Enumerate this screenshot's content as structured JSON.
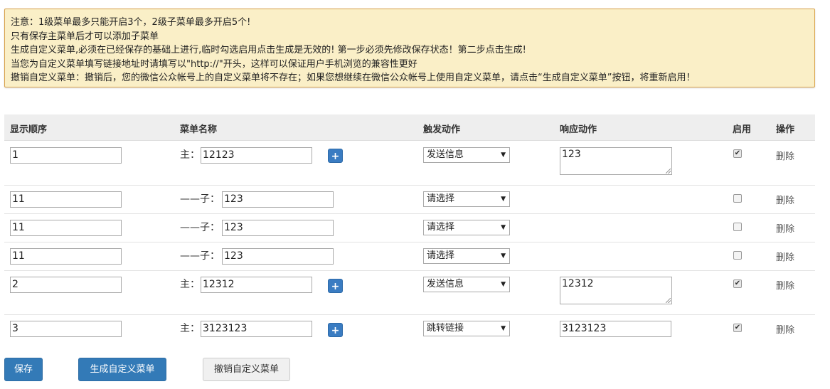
{
  "notice": [
    "注意：1级菜单最多只能开启3个，2级子菜单最多开启5个!",
    "只有保存主菜单后才可以添加子菜单",
    "生成自定义菜单,必须在已经保存的基础上进行,临时勾选启用点击生成是无效的! 第一步必须先修改保存状态！第二步点击生成!",
    "当您为自定义菜单填写链接地址时请填写以\"http://\"开头，这样可以保证用户手机浏览的兼容性更好",
    "撤销自定义菜单：撤销后，您的微信公众帐号上的自定义菜单将不存在；如果您想继续在微信公众帐号上使用自定义菜单，请点击“生成自定义菜单”按钮，将重新启用！"
  ],
  "headers": {
    "order": "显示顺序",
    "name": "菜单名称",
    "trigger": "触发动作",
    "response": "响应动作",
    "enabled": "启用",
    "ops": "操作"
  },
  "rows": [
    {
      "order": "1",
      "prefix": "主：",
      "name": "12123",
      "trigger": "发送信息",
      "response": "123",
      "enabled": true,
      "delete": "删除"
    },
    {
      "order": "11",
      "prefix": "——子：",
      "name": "123",
      "trigger": "请选择",
      "response": "",
      "enabled": false,
      "delete": "删除"
    },
    {
      "order": "11",
      "prefix": "——子：",
      "name": "123",
      "trigger": "请选择",
      "response": "",
      "enabled": false,
      "delete": "删除"
    },
    {
      "order": "11",
      "prefix": "——子：",
      "name": "123",
      "trigger": "请选择",
      "response": "",
      "enabled": false,
      "delete": "删除"
    },
    {
      "order": "2",
      "prefix": "主：",
      "name": "12312",
      "trigger": "发送信息",
      "response": "12312",
      "enabled": true,
      "delete": "删除"
    },
    {
      "order": "3",
      "prefix": "主：",
      "name": "3123123",
      "trigger": "跳转链接",
      "response": "3123123",
      "enabled": true,
      "delete": "删除"
    }
  ],
  "add_label": "+",
  "buttons": {
    "save": "保存",
    "generate": "生成自定义菜单",
    "revoke": "撤销自定义菜单"
  },
  "colors": {
    "notice_bg": "#faefc7",
    "notice_border": "#d9a24b",
    "primary": "#337ab7"
  }
}
